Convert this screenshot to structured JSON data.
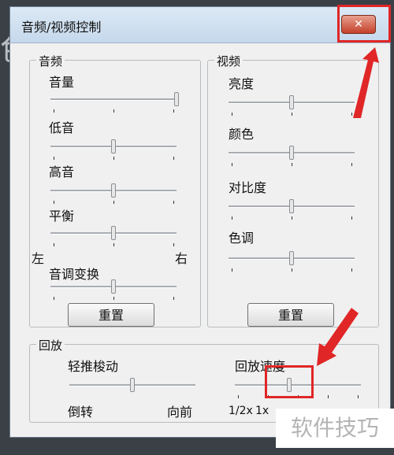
{
  "window": {
    "title": "音频/视频控制",
    "close_label": "✕"
  },
  "audio": {
    "title": "音频",
    "volume_label": "音量",
    "bass_label": "低音",
    "treble_label": "高音",
    "balance_label": "平衡",
    "balance_left": "左",
    "balance_right": "右",
    "pitch_label": "音调变换",
    "reset_label": "重置",
    "levels": {
      "volume": 1.0,
      "bass": 0.5,
      "treble": 0.5,
      "balance": 0.5,
      "pitch": 0.5
    }
  },
  "video": {
    "title": "视频",
    "brightness_label": "亮度",
    "color_label": "颜色",
    "contrast_label": "对比度",
    "hue_label": "色调",
    "reset_label": "重置",
    "levels": {
      "brightness": 0.5,
      "color": 0.5,
      "contrast": 0.5,
      "hue": 0.5
    }
  },
  "playback": {
    "title": "回放",
    "jog_label": "轻推梭动",
    "jog_reverse": "倒转",
    "jog_forward": "向前",
    "speed_label": "回放速度",
    "speed_half": "1/2x",
    "speed_one": "1x",
    "levels": {
      "jog": 0.5,
      "speed": 0.43
    }
  },
  "watermark": "软件技巧",
  "highlight_color": "#e02626"
}
